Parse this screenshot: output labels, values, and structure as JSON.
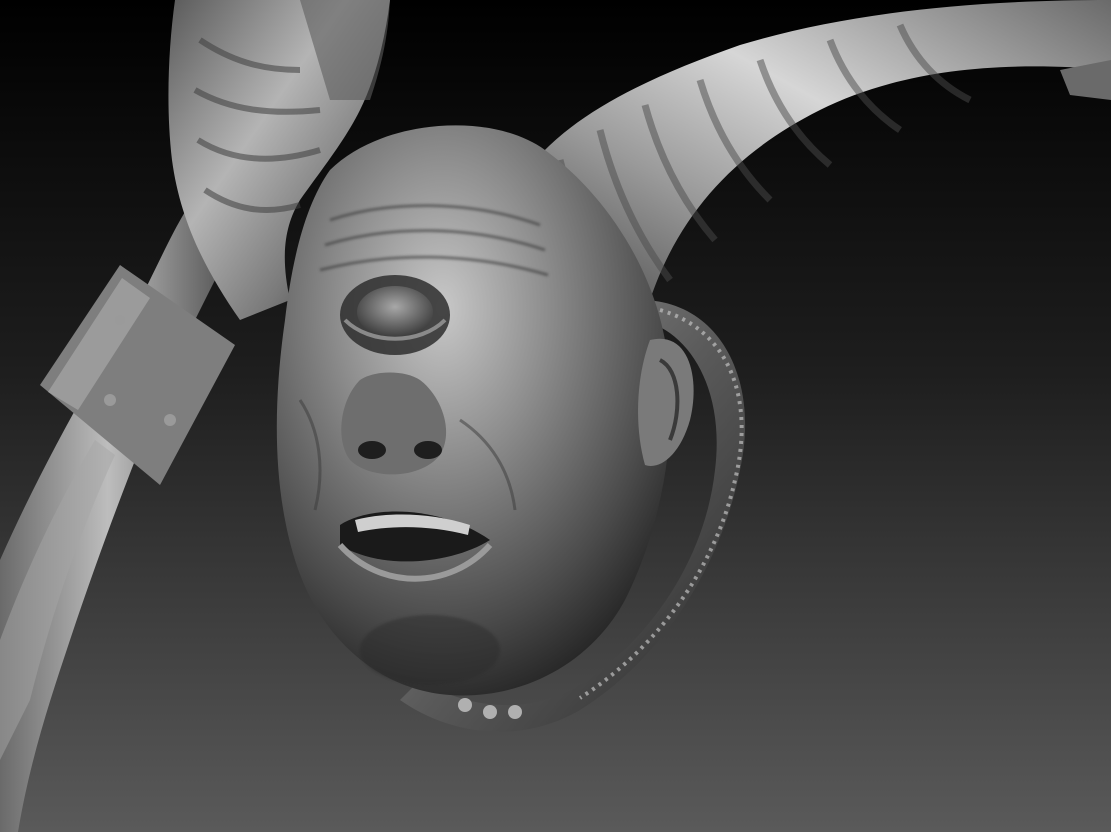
{
  "viewport": {
    "background_top": "#000000",
    "background_bottom": "#5a5a5a"
  },
  "subject": {
    "material_base": "#8a8a8a",
    "material_highlight": "#e0e0e0",
    "material_shadow": "#1a1a1a"
  }
}
